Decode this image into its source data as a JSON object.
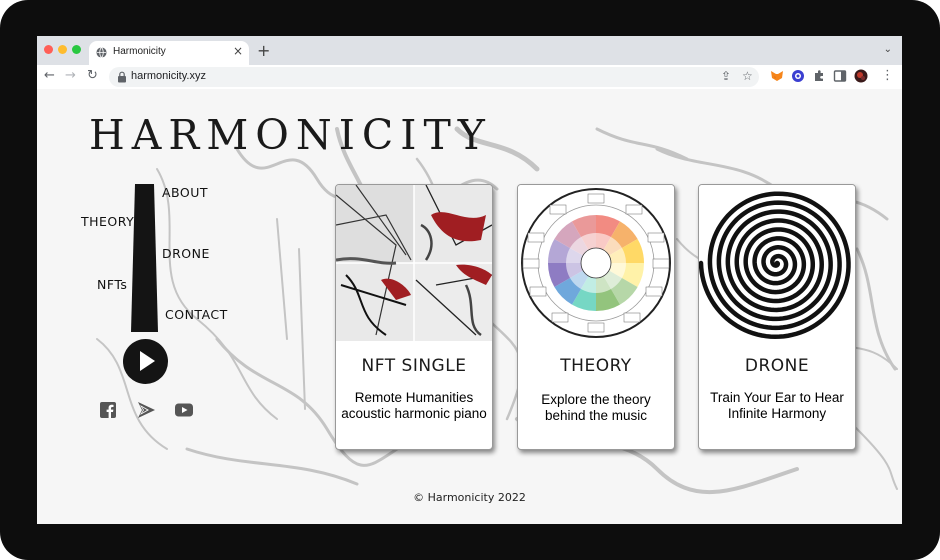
{
  "browser": {
    "tab_title": "Harmonicity",
    "new_tab": "+",
    "tab_close": "×",
    "url": "harmonicity.xyz",
    "back": "←",
    "forward": "→",
    "reload": "↻",
    "share": "⇪",
    "bookmark": "☆",
    "tabs_menu": "⌄",
    "more": "⋮"
  },
  "site": {
    "logo": "HARMONICITY",
    "menu": {
      "about": "ABOUT",
      "theory": "THEORY",
      "drone": "DRONE",
      "nfts": "NFTs",
      "contact": "CONTACT"
    },
    "cards": [
      {
        "title": "NFT SINGLE",
        "desc_line1": "Remote Humanities",
        "desc_line2": "acoustic harmonic piano"
      },
      {
        "title": "THEORY",
        "desc_line1": "Explore the theory",
        "desc_line2": "behind the music"
      },
      {
        "title": "DRONE",
        "desc_line1": "Train Your Ear to Hear",
        "desc_line2": "Infinite Harmony"
      }
    ],
    "footer": "© Harmonicity 2022"
  },
  "icons": {
    "tab": "globe-icon",
    "lock": "lock-icon",
    "play": "play-icon",
    "social": [
      "facebook-icon",
      "send-icon",
      "youtube-icon"
    ]
  },
  "colors": {
    "tabbar": "#dee1e6",
    "dark": "#141414",
    "nft_red": "#a01e22"
  }
}
